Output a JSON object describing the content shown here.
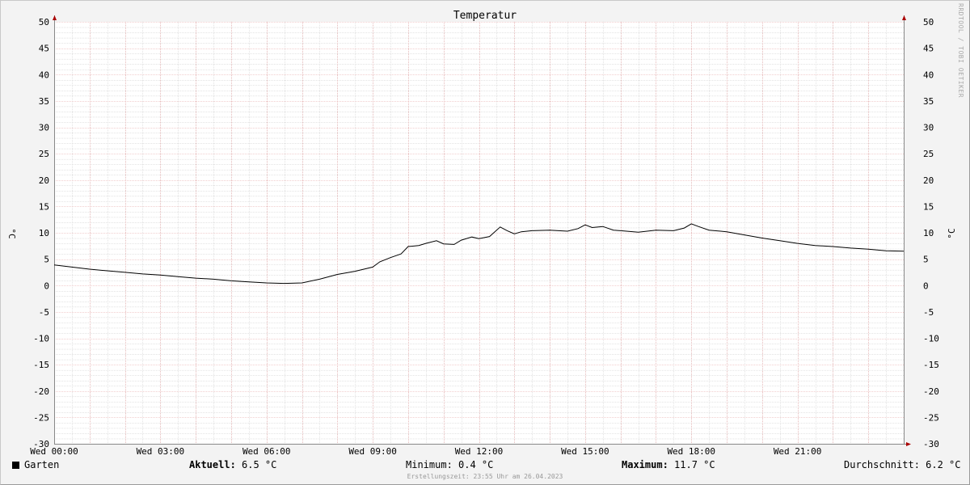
{
  "chart_data": {
    "type": "line",
    "title": "Temperatur",
    "ylabel_left": "°C",
    "ylabel_right": "°C",
    "ylim": [
      -30,
      50
    ],
    "yticks": [
      -30,
      -25,
      -20,
      -15,
      -10,
      -5,
      0,
      5,
      10,
      15,
      20,
      25,
      30,
      35,
      40,
      45,
      50
    ],
    "xlim": [
      0,
      24
    ],
    "xticks": [
      {
        "hour": 0,
        "label": "Wed 00:00"
      },
      {
        "hour": 3,
        "label": "Wed 03:00"
      },
      {
        "hour": 6,
        "label": "Wed 06:00"
      },
      {
        "hour": 9,
        "label": "Wed 09:00"
      },
      {
        "hour": 12,
        "label": "Wed 12:00"
      },
      {
        "hour": 15,
        "label": "Wed 15:00"
      },
      {
        "hour": 18,
        "label": "Wed 18:00"
      },
      {
        "hour": 21,
        "label": "Wed 21:00"
      }
    ],
    "series": [
      {
        "name": "Garten",
        "color": "#000000",
        "x": [
          0.0,
          0.5,
          1.0,
          1.5,
          2.0,
          2.5,
          3.0,
          3.5,
          4.0,
          4.5,
          5.0,
          5.5,
          6.0,
          6.5,
          7.0,
          7.5,
          8.0,
          8.5,
          9.0,
          9.2,
          9.5,
          9.8,
          10.0,
          10.3,
          10.5,
          10.8,
          11.0,
          11.3,
          11.5,
          11.8,
          12.0,
          12.3,
          12.6,
          12.8,
          13.0,
          13.2,
          13.5,
          14.0,
          14.5,
          14.8,
          15.0,
          15.2,
          15.5,
          15.8,
          16.0,
          16.5,
          17.0,
          17.5,
          17.8,
          18.0,
          18.2,
          18.5,
          19.0,
          19.5,
          20.0,
          20.5,
          21.0,
          21.5,
          22.0,
          22.5,
          23.0,
          23.5,
          24.0
        ],
        "y": [
          3.9,
          3.5,
          3.1,
          2.8,
          2.5,
          2.2,
          2.0,
          1.7,
          1.4,
          1.2,
          0.9,
          0.7,
          0.5,
          0.4,
          0.5,
          1.2,
          2.1,
          2.7,
          3.5,
          4.5,
          5.3,
          6.0,
          7.4,
          7.6,
          8.0,
          8.5,
          7.9,
          7.8,
          8.6,
          9.2,
          8.9,
          9.3,
          11.1,
          10.4,
          9.8,
          10.2,
          10.4,
          10.5,
          10.3,
          10.8,
          11.5,
          11.0,
          11.2,
          10.5,
          10.4,
          10.1,
          10.5,
          10.4,
          10.9,
          11.7,
          11.2,
          10.5,
          10.2,
          9.6,
          9.0,
          8.5,
          8.0,
          7.6,
          7.4,
          7.1,
          6.9,
          6.6,
          6.5
        ]
      }
    ],
    "legend": {
      "series_label": "Garten",
      "current_label": "Aktuell:",
      "current_value": "6.5 °C",
      "min_label": "Minimum:",
      "min_value": "0.4 °C",
      "max_label": "Maximum:",
      "max_value": "11.7 °C",
      "avg_label": "Durchschnitt:",
      "avg_value": "6.2 °C"
    },
    "footer": "Erstellungszeit: 23:55 Uhr am 26.04.2023",
    "watermark": "RRDTOOL / TOBI OETIKER",
    "grid": true,
    "colors": {
      "background": "#f3f3f3",
      "plot_background": "#ffffff",
      "minor_grid": "#c8c8c8",
      "major_grid": "#e6a0a0",
      "axis": "#888888",
      "arrow": "#aa0000",
      "line": "#000000"
    }
  }
}
